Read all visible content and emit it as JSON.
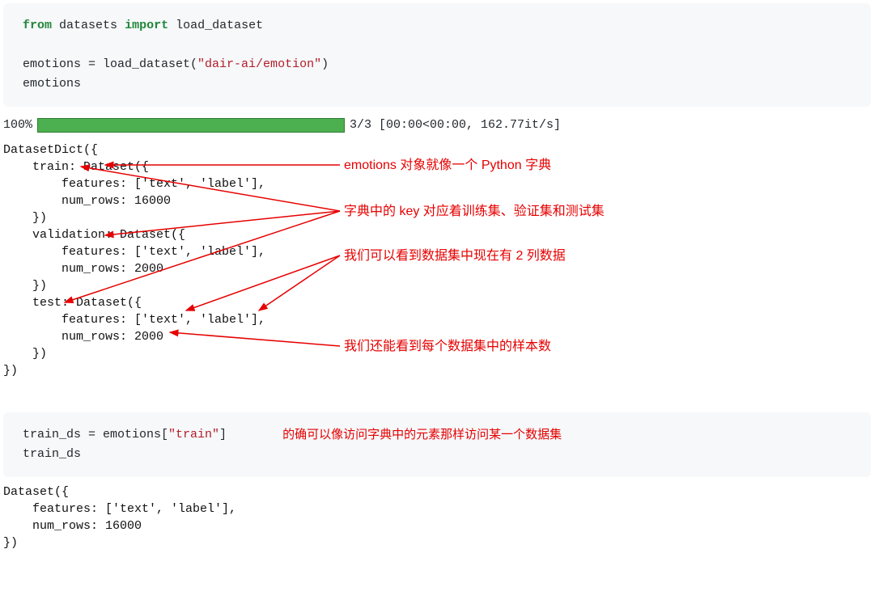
{
  "code1": {
    "from": "from",
    "mod": "datasets",
    "imp": "import",
    "fn": "load_dataset",
    "line2_pre": "emotions = load_dataset(",
    "line2_str": "\"dair-ai/emotion\"",
    "line2_post": ")",
    "line3": "emotions"
  },
  "progress": {
    "pct": "100%",
    "stats": "3/3 [00:00<00:00, 162.77it/s]"
  },
  "output1": {
    "l1": "DatasetDict({",
    "l2": "    train: Dataset({",
    "l3": "        features: ['text', 'label'],",
    "l4": "        num_rows: 16000",
    "l5": "    })",
    "l6": "    validation: Dataset({",
    "l7": "        features: ['text', 'label'],",
    "l8": "        num_rows: 2000",
    "l9": "    })",
    "l10": "    test: Dataset({",
    "l11": "        features: ['text', 'label'],",
    "l12": "        num_rows: 2000",
    "l13": "    })",
    "l14": "})"
  },
  "ann": {
    "a1": "emotions 对象就像一个 Python 字典",
    "a2": "字典中的 key 对应着训练集、验证集和测试集",
    "a3": "我们可以看到数据集中现在有 2 列数据",
    "a4": "我们还能看到每个数据集中的样本数",
    "a5": "的确可以像访问字典中的元素那样访问某一个数据集"
  },
  "code2": {
    "line1_pre": "train_ds = emotions[",
    "line1_str": "\"train\"",
    "line1_post": "]",
    "line2": "train_ds"
  },
  "output2": {
    "l1": "Dataset({",
    "l2": "    features: ['text', 'label'],",
    "l3": "    num_rows: 16000",
    "l4": "})"
  }
}
